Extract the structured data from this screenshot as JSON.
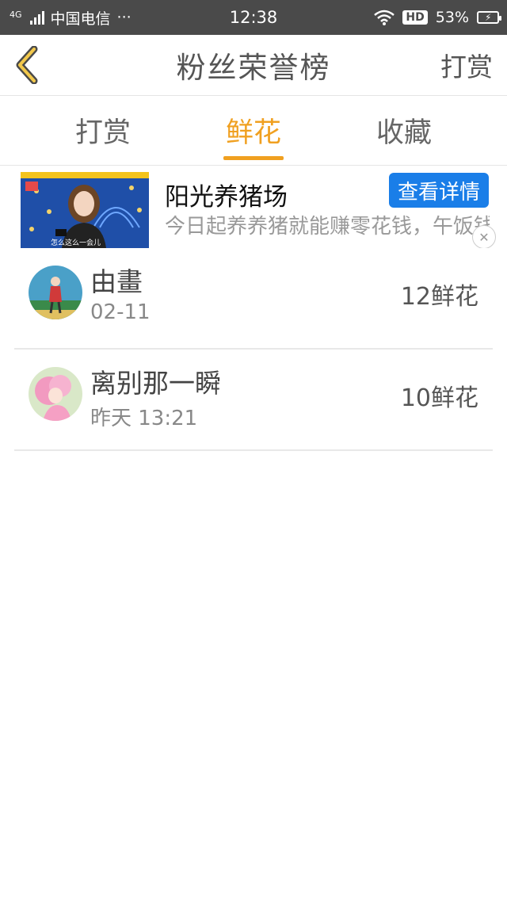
{
  "status_bar": {
    "network": "4G",
    "carrier": "中国电信",
    "more": "···",
    "time": "12:38",
    "hd": "HD",
    "battery": "53%"
  },
  "header": {
    "title": "粉丝荣誉榜",
    "right_button": "打赏",
    "back_icon": "back-chevron-icon",
    "accent_color": "#f0a020"
  },
  "tabs": [
    {
      "label": "打赏",
      "active": false
    },
    {
      "label": "鲜花",
      "active": true
    },
    {
      "label": "收藏",
      "active": false
    }
  ],
  "ad": {
    "title": "阳光养猪场",
    "button": "查看详情",
    "description": "今日起养养猪就能赚零花钱，午饭钱轻轻松松就有啦",
    "thumb_caption": "怎么这么一会儿",
    "close_icon": "close-icon",
    "button_color": "#1a7ee8"
  },
  "list": [
    {
      "name": "由畫",
      "date": "02-11",
      "amount": "12鲜花"
    },
    {
      "name": "离别那一瞬",
      "date": "昨天 13:21",
      "amount": "10鲜花"
    }
  ]
}
